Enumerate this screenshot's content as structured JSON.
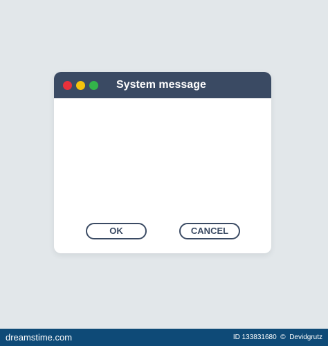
{
  "dialog": {
    "title": "System message",
    "ok_label": "OK",
    "cancel_label": "CANCEL",
    "controls": {
      "close_color": "#e8313b",
      "minimize_color": "#f4c20d",
      "maximize_color": "#33b44a"
    },
    "colors": {
      "titlebar": "#3a4a63",
      "background": "#ffffff",
      "page": "#e2e7ea"
    }
  },
  "footer": {
    "brand": "dreamstime.com",
    "image_id": "ID 133831680",
    "author": "Devidgrutz",
    "color": "#0e4a77"
  }
}
